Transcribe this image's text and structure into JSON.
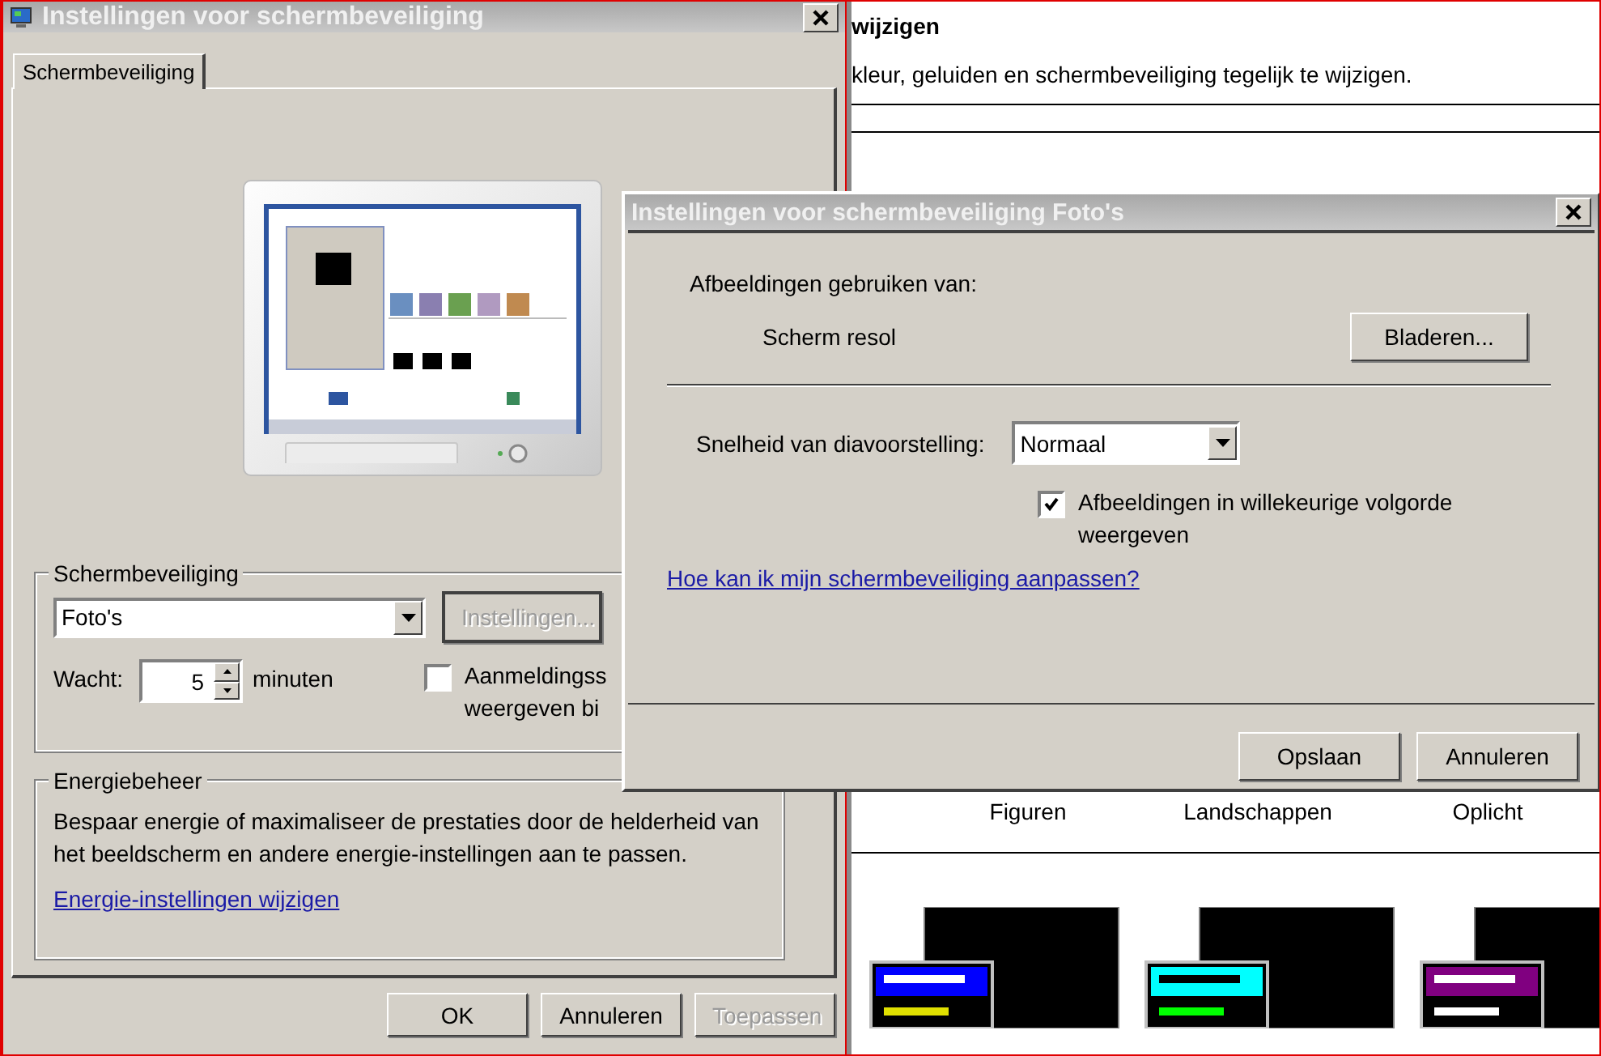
{
  "background_window": {
    "heading": "wijzigen",
    "description": "kleur, geluiden en schermbeveiliging tegelijk te wijzigen.",
    "theme_labels": [
      "Figuren",
      "Landschappen",
      "Oplicht"
    ],
    "theme_previews": [
      {
        "color": "#0000ff"
      },
      {
        "color": "#00ffff"
      },
      {
        "color": "#800080"
      }
    ]
  },
  "settings_window": {
    "title": "Instellingen voor schermbeveiliging",
    "tabs": [
      {
        "label": "Schermbeveiliging",
        "selected": true
      }
    ],
    "screensaver_group": {
      "legend": "Schermbeveiliging",
      "screensaver": "Foto's",
      "settings_button": {
        "label": "Instellingen...",
        "disabled": true
      },
      "wait_label": "Wacht:",
      "wait_value": "5",
      "wait_unit": "minuten",
      "logon_checkbox": {
        "checked": false,
        "label_lines": [
          "Aanmeldingss",
          "weergeven bi"
        ]
      }
    },
    "energy_group": {
      "legend": "Energiebeheer",
      "text": "Bespaar energie of maximaliseer de prestaties door de helderheid van het beeldscherm en andere energie-instellingen aan te passen.",
      "link": "Energie-instellingen wijzigen"
    },
    "buttons": [
      {
        "label": "OK",
        "disabled": false
      },
      {
        "label": "Annuleren",
        "disabled": false
      },
      {
        "label": "Toepassen",
        "disabled": true
      }
    ]
  },
  "photos_dialog": {
    "title": "Instellingen voor schermbeveiliging Foto's",
    "source_label": "Afbeeldingen gebruiken van:",
    "source_value": "Scherm resol",
    "browse_button": "Bladeren...",
    "speed_label": "Snelheid van diavoorstelling:",
    "speed_value": "Normaal",
    "shuffle_checkbox": {
      "checked": true,
      "label": "Afbeeldingen in willekeurige volgorde weergeven"
    },
    "help_link": "Hoe kan ik mijn schermbeveiliging aanpassen?",
    "buttons": [
      {
        "label": "Opslaan",
        "disabled": false
      },
      {
        "label": "Annuleren",
        "disabled": false
      }
    ]
  }
}
